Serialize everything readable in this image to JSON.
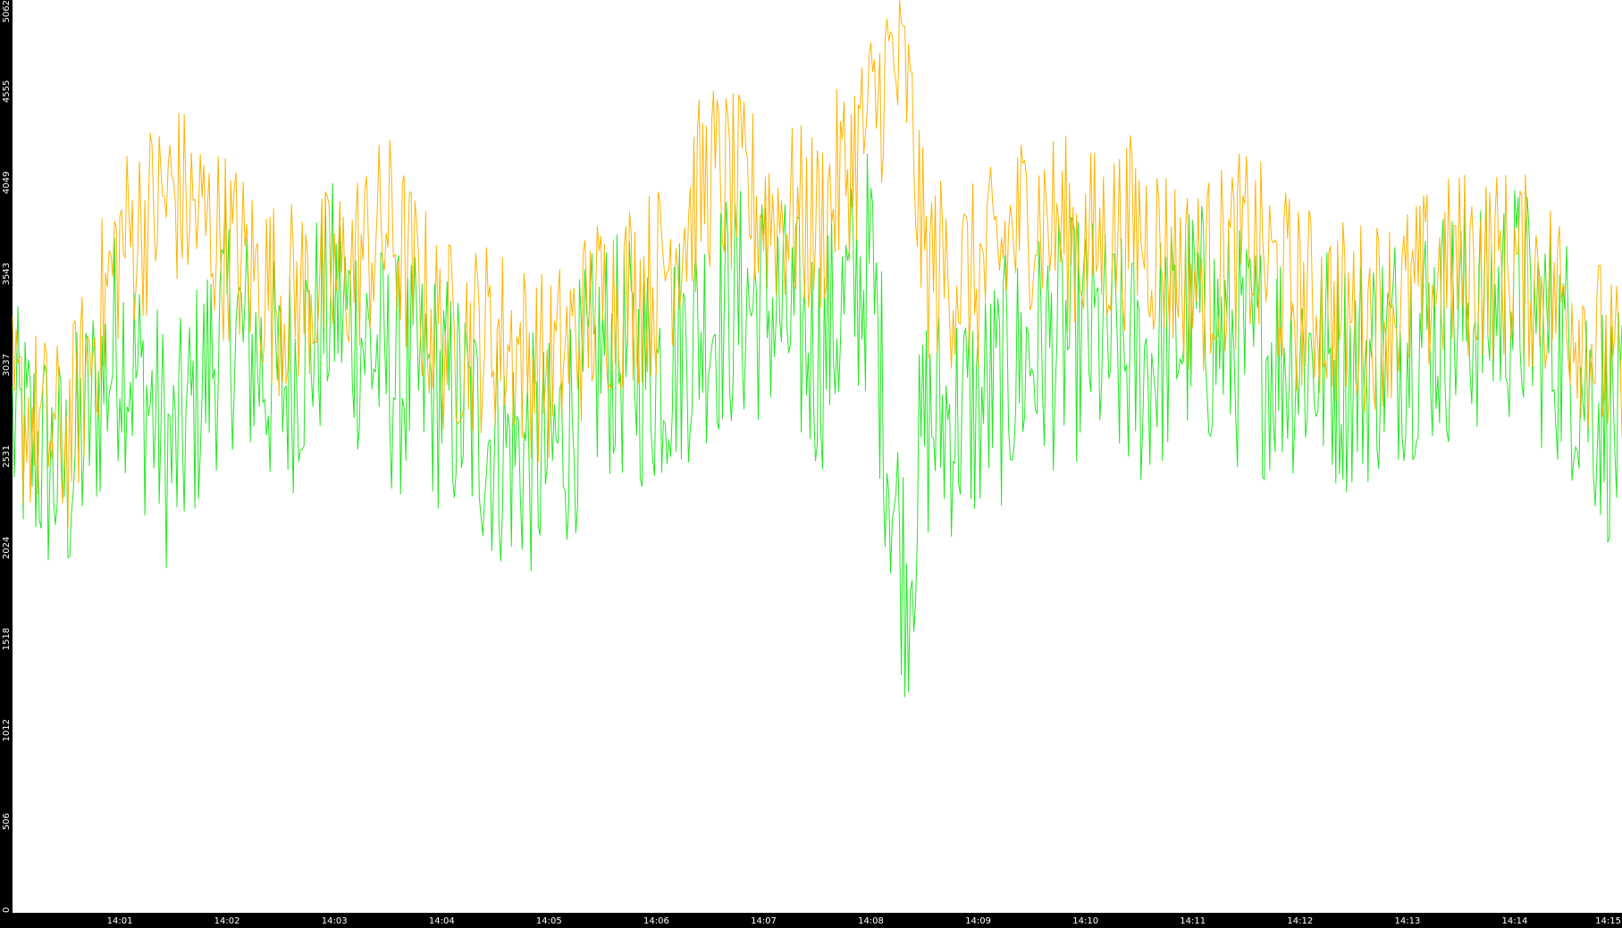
{
  "colors": {
    "background": "#000000",
    "plot_background": "#ffffff",
    "axis_text": "#ffffff",
    "series_green": "#22e822",
    "series_orange": "#ffb400"
  },
  "chart_data": {
    "type": "line",
    "title": "",
    "xlabel": "",
    "ylabel": "",
    "grid": false,
    "legend": "none",
    "ylim": [
      0,
      5062
    ],
    "y_ticks": [
      {
        "label": "0",
        "value": 0
      },
      {
        "label": "506",
        "value": 506
      },
      {
        "label": "1012",
        "value": 1012
      },
      {
        "label": "1518",
        "value": 1518
      },
      {
        "label": "2024",
        "value": 2024
      },
      {
        "label": "2531",
        "value": 2531
      },
      {
        "label": "3037",
        "value": 3037
      },
      {
        "label": "3543",
        "value": 3543
      },
      {
        "label": "4049",
        "value": 4049
      },
      {
        "label": "4555",
        "value": 4555
      },
      {
        "label": "5062",
        "value": 5062
      }
    ],
    "x_range": [
      "14:00",
      "14:15"
    ],
    "x_ticks": [
      "14:01",
      "14:02",
      "14:03",
      "14:04",
      "14:05",
      "14:06",
      "14:07",
      "14:08",
      "14:09",
      "14:10",
      "14:11",
      "14:12",
      "14:13",
      "14:14",
      "14:15"
    ],
    "series": [
      {
        "color_key": "series_green",
        "x": [
          "14:00",
          "14:00:30",
          "14:01",
          "14:01:30",
          "14:02",
          "14:02:30",
          "14:03",
          "14:03:30",
          "14:04",
          "14:04:30",
          "14:05",
          "14:05:30",
          "14:06",
          "14:06:30",
          "14:07",
          "14:07:30",
          "14:08",
          "14:08:10",
          "14:08:20",
          "14:08:30",
          "14:09",
          "14:09:30",
          "14:10",
          "14:10:30",
          "14:11",
          "14:11:30",
          "14:12",
          "14:12:30",
          "14:13",
          "14:13:30",
          "14:14",
          "14:14:30",
          "14:15"
        ],
        "values": [
          2700,
          2400,
          3200,
          2500,
          3300,
          2900,
          3400,
          3000,
          2900,
          2600,
          2500,
          3100,
          3000,
          3300,
          3400,
          3100,
          3600,
          2500,
          1800,
          2700,
          2800,
          3100,
          3200,
          3000,
          3300,
          3100,
          3100,
          3000,
          3200,
          3300,
          3400,
          3100,
          2600
        ]
      },
      {
        "color_key": "series_orange",
        "x": [
          "14:00",
          "14:00:30",
          "14:01",
          "14:01:30",
          "14:02",
          "14:02:30",
          "14:03",
          "14:03:30",
          "14:04",
          "14:04:30",
          "14:05",
          "14:05:30",
          "14:06",
          "14:06:30",
          "14:07",
          "14:07:30",
          "14:08",
          "14:08:10",
          "14:08:20",
          "14:08:30",
          "14:09",
          "14:09:30",
          "14:10",
          "14:10:30",
          "14:11",
          "14:11:30",
          "14:12",
          "14:12:30",
          "14:13",
          "14:13:30",
          "14:14",
          "14:14:30",
          "14:15"
        ],
        "values": [
          2800,
          2600,
          3700,
          4000,
          3700,
          3400,
          3500,
          3800,
          3200,
          3200,
          3000,
          3400,
          3500,
          4100,
          3900,
          3800,
          4400,
          4700,
          4600,
          3600,
          3500,
          3900,
          3700,
          3800,
          3500,
          3700,
          3400,
          3300,
          3400,
          3600,
          3600,
          3400,
          2900
        ]
      }
    ]
  }
}
